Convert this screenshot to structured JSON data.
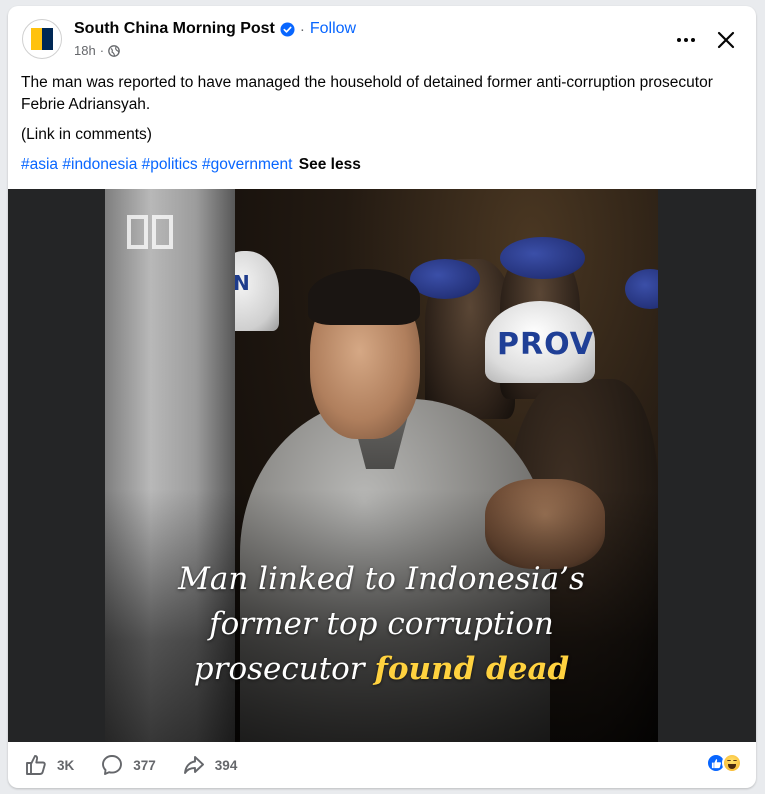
{
  "post": {
    "page_name": "South China Morning Post",
    "separator": "·",
    "follow_label": "Follow",
    "timestamp": "18h",
    "timestamp_separator": "·",
    "text_main": "The man was reported to have managed the household of detained former anti-corruption prosecutor Febrie Adriansyah.",
    "text_link": "(Link in comments)",
    "hashtags": [
      "#asia",
      "#indonesia",
      "#politics",
      "#government"
    ],
    "see_less_label": "See less"
  },
  "media": {
    "caption_line1": "Man linked to Indonesia’s",
    "caption_line2": "former top corruption",
    "caption_line3_prefix": "prosecutor",
    "caption_line3_highlight": "found dead",
    "helmet_left_text": "N",
    "helmet_text": "PROV"
  },
  "actions": {
    "like_count": "3K",
    "comment_count": "377",
    "share_count": "394"
  },
  "icons": {
    "verified": "verified-badge-icon",
    "globe": "globe-icon",
    "more": "more-options-icon",
    "close": "close-icon",
    "like": "like-icon",
    "comment": "comment-icon",
    "share": "share-icon"
  },
  "colors": {
    "brand_blue": "#0866ff",
    "secondary_text": "#65676b",
    "caption_highlight": "#ffd23f",
    "scmp_yellow": "#ffc20e",
    "scmp_navy": "#002855"
  }
}
